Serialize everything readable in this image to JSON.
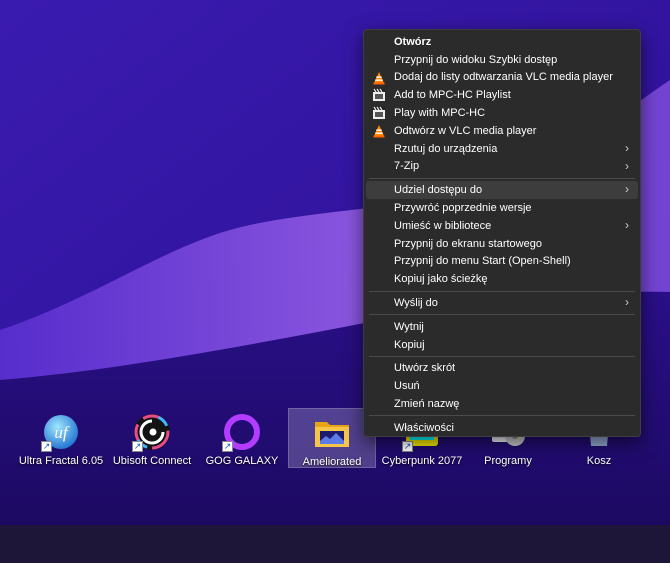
{
  "desktop": {
    "icons": [
      {
        "label": "Ultra Fractal 6.05",
        "icon": "ultra-fractal-icon",
        "shortcut": true
      },
      {
        "label": "Ubisoft Connect",
        "icon": "ubisoft-connect-icon",
        "shortcut": true
      },
      {
        "label": "GOG GALAXY",
        "icon": "gog-galaxy-icon",
        "shortcut": true
      },
      {
        "label": "Ameliorated",
        "icon": "folder-icon",
        "selected": true
      },
      {
        "label": "Cyberpunk 2077",
        "icon": "cyberpunk-icon",
        "shortcut": true
      },
      {
        "label": "Programy",
        "icon": "programs-icon"
      },
      {
        "label": "Kosz",
        "icon": "recycle-bin-icon"
      }
    ]
  },
  "context_menu": {
    "items": [
      {
        "label": "Otwórz",
        "bold": true
      },
      {
        "label": "Przypnij do widoku Szybki dostęp"
      },
      {
        "label": "Dodaj do listy odtwarzania VLC media player",
        "icon": "vlc-icon"
      },
      {
        "label": "Add to MPC-HC Playlist",
        "icon": "mpc-hc-icon"
      },
      {
        "label": "Play with MPC-HC",
        "icon": "mpc-hc-icon"
      },
      {
        "label": "Odtwórz w VLC media player",
        "icon": "vlc-icon"
      },
      {
        "label": "Rzutuj do urządzenia",
        "submenu": true
      },
      {
        "label": "7-Zip",
        "submenu": true
      },
      {
        "separator": true
      },
      {
        "label": "Udziel dostępu do",
        "submenu": true,
        "highlighted": true
      },
      {
        "label": "Przywróć poprzednie wersje"
      },
      {
        "label": "Umieść w bibliotece",
        "submenu": true
      },
      {
        "label": "Przypnij do ekranu startowego"
      },
      {
        "label": "Przypnij do menu Start (Open-Shell)"
      },
      {
        "label": "Kopiuj jako ścieżkę"
      },
      {
        "separator": true
      },
      {
        "label": "Wyślij do",
        "submenu": true
      },
      {
        "separator": true
      },
      {
        "label": "Wytnij"
      },
      {
        "label": "Kopiuj"
      },
      {
        "separator": true
      },
      {
        "label": "Utwórz skrót"
      },
      {
        "label": "Usuń"
      },
      {
        "label": "Zmień nazwę"
      },
      {
        "separator": true
      },
      {
        "label": "Właściwości"
      }
    ],
    "submenu_arrow": "›"
  },
  "colors": {
    "menu_background": "#2b2b2b",
    "menu_highlight": "#3d3d3d",
    "separator": "#4a4a4a",
    "taskbar": "#1d1638",
    "wallpaper_base": "#3312a0"
  }
}
